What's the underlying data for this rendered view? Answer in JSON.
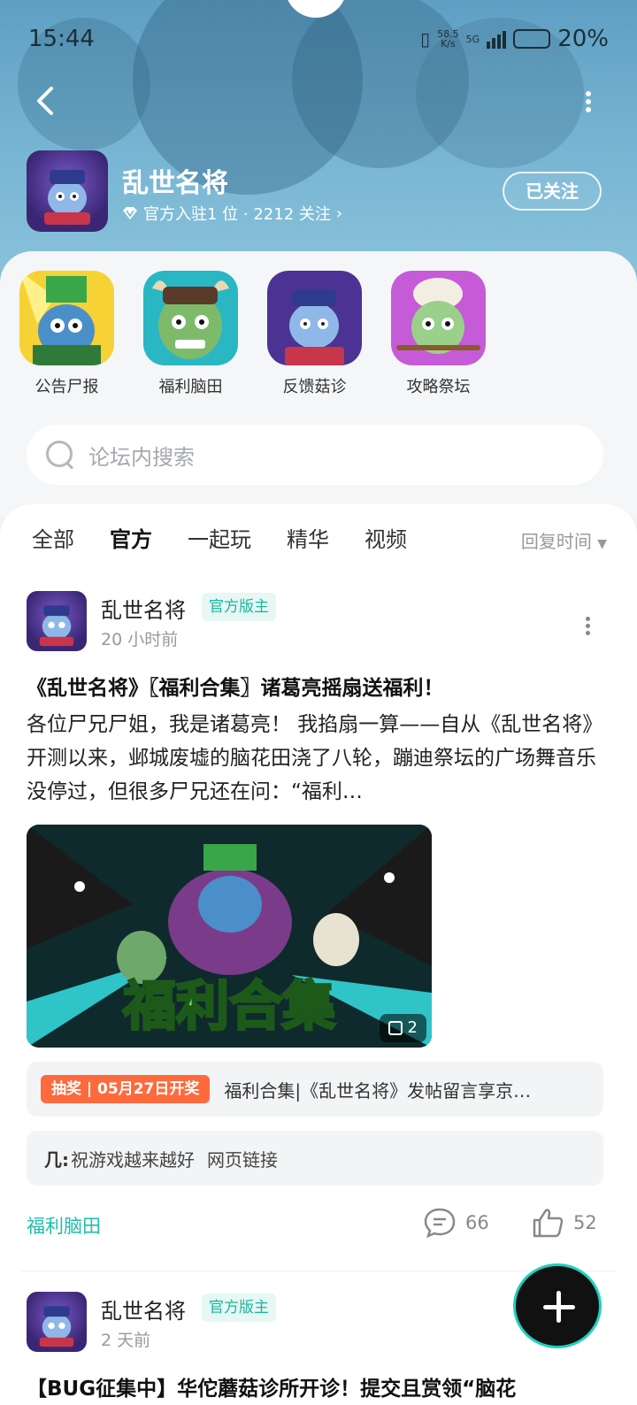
{
  "status_bar": {
    "time": "15:44",
    "net_speed": "58.5",
    "net_unit": "K/s",
    "signal": "5G",
    "battery": "20%",
    "battery_level": 0.2
  },
  "header": {
    "game_name": "乱世名将",
    "meta": "官方入驻1 位 · 2212 关注",
    "follow_label": "已关注"
  },
  "shortcuts": [
    {
      "label": "公告尸报",
      "icon": "zombie-general-icon"
    },
    {
      "label": "福利脑田",
      "icon": "zombie-ogre-icon"
    },
    {
      "label": "反馈菇诊",
      "icon": "zombie-scholar-icon"
    },
    {
      "label": "攻略祭坛",
      "icon": "zombie-chef-icon"
    }
  ],
  "search": {
    "placeholder": "论坛内搜索"
  },
  "tabs": [
    "全部",
    "官方",
    "一起玩",
    "精华",
    "视频"
  ],
  "active_tab": "官方",
  "sort_label": "回复时间",
  "posts": [
    {
      "author": "乱世名将",
      "badge": "官方版主",
      "time": "20 小时前",
      "title": "《乱世名将》〖福利合集〗诸葛亮摇扇送福利！",
      "body": "各位尸兄尸姐，我是诸葛亮！ 我掐扇一算——自从《乱世名将》开测以来，邺城废墟的脑花田浇了八轮，蹦迪祭坛的广场舞音乐没停过，但很多尸兄还在问：“福利…",
      "image_banner_text": "福利合集",
      "image_count": "2",
      "lottery_tag": "抽奖 | 05月27日开奖",
      "lottery_text": "福利合集|《乱世名将》发帖留言享京…",
      "comment_user": "几:",
      "comment_text": "祝游戏越来越好",
      "comment_link": "网页链接",
      "forum": "福利脑田",
      "comments": "66",
      "likes": "52"
    },
    {
      "author": "乱世名将",
      "badge": "官方版主",
      "time": "2 天前",
      "title": "【BUG征集中】华佗蘑菇诊所开诊！提交且赏领“脑花"
    }
  ],
  "colors": {
    "accent": "#1cc0a8",
    "lottery": "#ff6a3d",
    "banner": "#6fb0cf"
  }
}
